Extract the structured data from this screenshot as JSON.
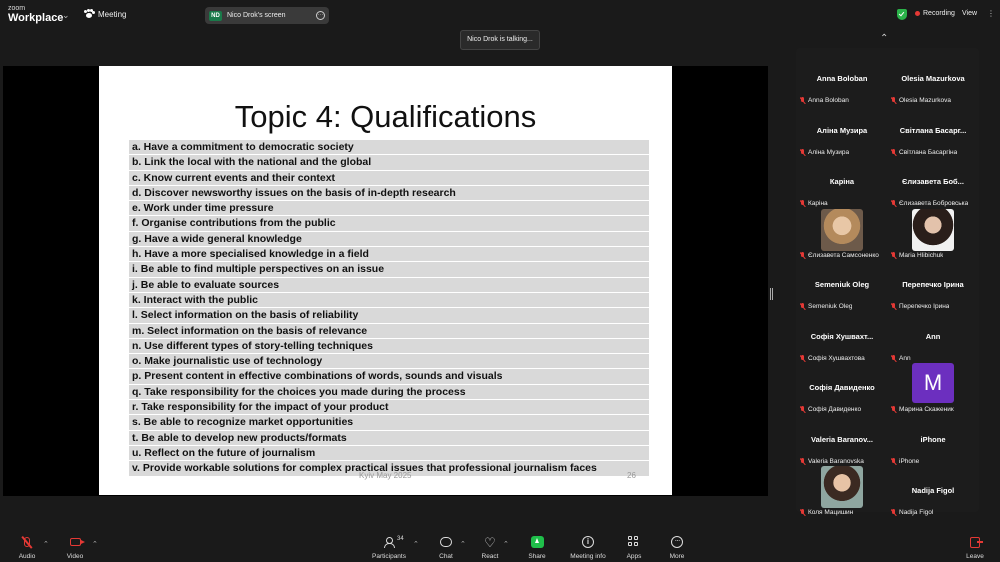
{
  "app": {
    "brand_top": "zoom",
    "brand_name": "Workplace"
  },
  "topbar": {
    "meeting_label": "Meeting",
    "share_badge": "ND",
    "share_label": "Nico Drok's screen",
    "recording_label": "Recording",
    "view_label": "View"
  },
  "talking": "Nico Drok is talking...",
  "slide": {
    "title": "Topic 4:  Qualifications",
    "items": [
      "a. Have a commitment to democratic society",
      "b. Link the local with the national and the global",
      "c. Know current events and their context",
      "d. Discover newsworthy issues on the basis of in-depth research",
      "e. Work under time pressure",
      "f. Organise contributions from the public",
      "g. Have a wide general knowledge",
      "h. Have a more specialised knowledge in a field",
      "i. Be able to find multiple perspectives on an issue",
      "j. Be able to evaluate sources",
      "k. Interact with the public",
      "l. Select information on the basis of reliability",
      "m. Select information on the basis of relevance",
      "n. Use different types of story-telling techniques",
      "o. Make journalistic use of technology",
      "p. Present content in effective combinations of words, sounds and visuals",
      "q. Take responsibility for the choices you made during the process",
      "r. Take responsibility for the impact of your product",
      "s. Be able to recognize market opportunities",
      "t. Be able to develop new products/formats",
      "u. Reflect on the future of journalism",
      "v. Provide workable solutions for complex practical issues that professional journalism faces"
    ],
    "footer": "Kyiv May 2025",
    "page_number": "26"
  },
  "participants": [
    {
      "name": "Anna Boloban",
      "label": "Anna Boloban",
      "video": ""
    },
    {
      "name": "Olesia Mazurkova",
      "label": "Olesia Mazurkova",
      "video": ""
    },
    {
      "name": "Аліна Музира",
      "label": "Аліна Музира",
      "video": ""
    },
    {
      "name": "Світлана  Басарг...",
      "label": "Світлана Басаргіна",
      "video": ""
    },
    {
      "name": "Каріна",
      "label": "Каріна",
      "video": ""
    },
    {
      "name": "Єлизавета  Боб...",
      "label": "Єлизавета Бобровська",
      "video": ""
    },
    {
      "name": "",
      "label": "Єлизавета Самсоненко",
      "video": "a"
    },
    {
      "name": "",
      "label": "Maria Hlibichuk",
      "video": "b"
    },
    {
      "name": "Semeniuk Oleg",
      "label": "Semeniuk Oleg",
      "video": ""
    },
    {
      "name": "Перепечко Ірина",
      "label": "Перепечко Ірина",
      "video": ""
    },
    {
      "name": "Софія  Хушвахт...",
      "label": "Софія Хушвахтова",
      "video": ""
    },
    {
      "name": "Ann",
      "label": "Ann",
      "video": ""
    },
    {
      "name": "Софія  Давиденко",
      "label": "Софія Давиденко",
      "video": ""
    },
    {
      "name": "",
      "label": "Марина Скаженик",
      "video": "M"
    },
    {
      "name": "Valeria  Baranov...",
      "label": "Valeria Baranovska",
      "video": ""
    },
    {
      "name": "iPhone",
      "label": "iPhone",
      "video": ""
    },
    {
      "name": "",
      "label": "Коля Мацишин",
      "video": "c"
    },
    {
      "name": "Nadija Figol",
      "label": "Nadija Figol",
      "video": ""
    }
  ],
  "toolbar": {
    "audio": "Audio",
    "video": "Video",
    "participants": "Participants",
    "participants_count": "34",
    "chat": "Chat",
    "react": "React",
    "share": "Share",
    "meeting_info": "Meeting info",
    "apps": "Apps",
    "more": "More",
    "leave": "Leave"
  },
  "colors": {
    "accent_red": "#e53935",
    "share_green": "#1fbf4a",
    "avatar_purple": "#6c2fbf"
  }
}
